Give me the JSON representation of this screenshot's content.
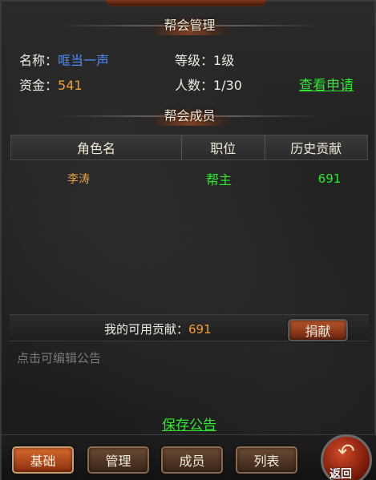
{
  "guild_management": {
    "title": "帮会管理",
    "name_label": "名称：",
    "name_value": "哐当一声",
    "level_label": "等级：",
    "level_value": "1级",
    "funds_label": "资金：",
    "funds_value": "541",
    "members_label": "人数：",
    "members_value": "1/30",
    "view_applications_link": "查看申请"
  },
  "guild_members": {
    "title": "帮会成员",
    "columns": [
      "角色名",
      "职位",
      "历史贡献"
    ],
    "rows": [
      {
        "name": "李涛",
        "position": "帮主",
        "contribution": "691"
      }
    ]
  },
  "contribution": {
    "label": "我的可用贡献：",
    "value": "691",
    "donate_button": "捐献"
  },
  "notice": {
    "placeholder": "点击可编辑公告",
    "save_link": "保存公告"
  },
  "tabs": [
    "基础",
    "管理",
    "成员",
    "列表"
  ],
  "active_tab": "基础",
  "return_button": "返回",
  "colors": {
    "green": "#2ee82e",
    "blue": "#4a8cff",
    "orange": "#f0a030",
    "name_orange": "#e8a040"
  }
}
